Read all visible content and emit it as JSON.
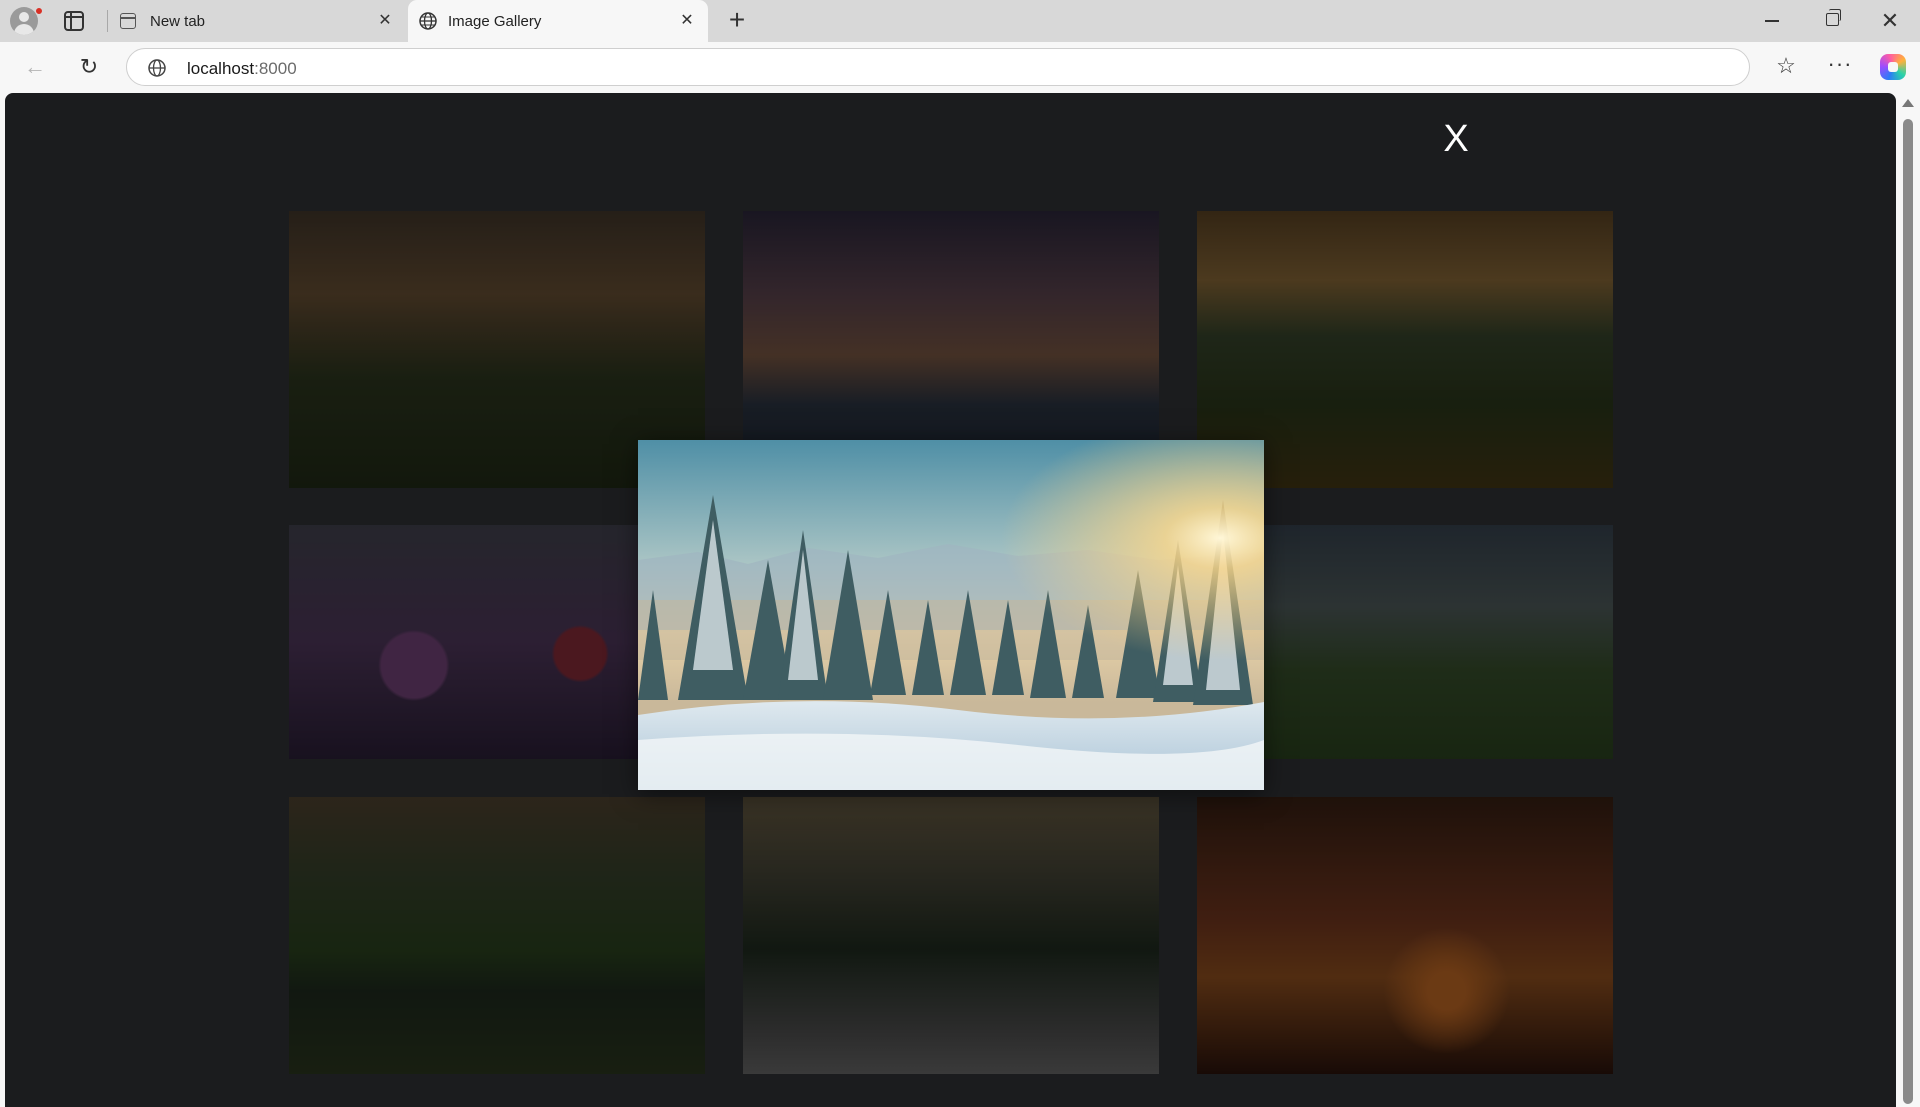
{
  "browser": {
    "tabs": [
      {
        "title": "New tab",
        "close": "✕"
      },
      {
        "title": "Image Gallery",
        "close": "✕"
      }
    ],
    "new_tab_label": "+",
    "address": {
      "host": "localhost",
      "port": ":8000"
    },
    "icons": {
      "back": "back-arrow-icon",
      "reload": "reload-icon",
      "favorites": "favorites-star-icon",
      "more": "more-dots-icon",
      "copilot": "copilot-icon"
    },
    "window_controls": {
      "close": "✕"
    }
  },
  "gallery": {
    "close_label": "X",
    "thumbnails": [
      {
        "subject": "mountain sunset meadow"
      },
      {
        "subject": "palm beach sunset"
      },
      {
        "subject": "valley with yellow flowers"
      },
      {
        "subject": "wildflower field"
      },
      {
        "subject": "snowy forest (enlarged)"
      },
      {
        "subject": "cloudy green meadow"
      },
      {
        "subject": "river through green marsh"
      },
      {
        "subject": "misty pine forest snow"
      },
      {
        "subject": "forest lake sunset"
      }
    ],
    "lightbox": {
      "subject": "snowy pine forest at sunrise"
    }
  }
}
